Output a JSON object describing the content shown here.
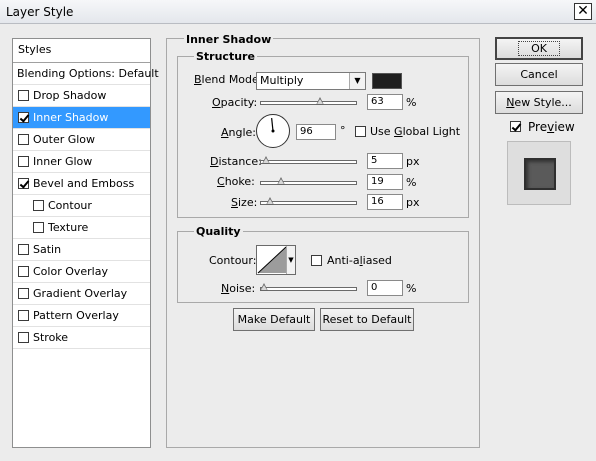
{
  "window": {
    "title": "Layer Style",
    "close_glyph": "✕"
  },
  "styles_panel": {
    "header": "Styles",
    "blending_options": "Blending Options: Default",
    "items": [
      {
        "label": "Drop Shadow",
        "checked": false,
        "active": false,
        "sub": false
      },
      {
        "label": "Inner Shadow",
        "checked": true,
        "active": true,
        "sub": false
      },
      {
        "label": "Outer Glow",
        "checked": false,
        "active": false,
        "sub": false
      },
      {
        "label": "Inner Glow",
        "checked": false,
        "active": false,
        "sub": false
      },
      {
        "label": "Bevel and Emboss",
        "checked": true,
        "active": false,
        "sub": false
      },
      {
        "label": "Contour",
        "checked": false,
        "active": false,
        "sub": true
      },
      {
        "label": "Texture",
        "checked": false,
        "active": false,
        "sub": true
      },
      {
        "label": "Satin",
        "checked": false,
        "active": false,
        "sub": false
      },
      {
        "label": "Color Overlay",
        "checked": false,
        "active": false,
        "sub": false
      },
      {
        "label": "Gradient Overlay",
        "checked": false,
        "active": false,
        "sub": false
      },
      {
        "label": "Pattern Overlay",
        "checked": false,
        "active": false,
        "sub": false
      },
      {
        "label": "Stroke",
        "checked": false,
        "active": false,
        "sub": false
      }
    ]
  },
  "inner_shadow": {
    "section_title": "Inner Shadow",
    "structure": {
      "title": "Structure",
      "blend_mode_label": "Blend Mode:",
      "blend_mode_value": "Multiply",
      "blend_color": "#1f1f1f",
      "opacity_label": "Opacity:",
      "opacity_value": "63",
      "opacity_unit": "%",
      "opacity_level": 0.63,
      "angle_label": "Angle:",
      "angle_value": "96",
      "angle_unit": "°",
      "angle_degrees": 96,
      "use_global_light_label": "Use Global Light",
      "use_global_light_checked": false,
      "distance_label": "Distance:",
      "distance_value": "5",
      "distance_unit": "px",
      "distance_level": 0.02,
      "choke_label": "Choke:",
      "choke_value": "19",
      "choke_unit": "%",
      "choke_level": 0.19,
      "size_label": "Size:",
      "size_value": "16",
      "size_unit": "px",
      "size_level": 0.065
    },
    "quality": {
      "title": "Quality",
      "contour_label": "Contour:",
      "anti_aliased_label": "Anti-aliased",
      "anti_aliased_checked": false,
      "noise_label": "Noise:",
      "noise_value": "0",
      "noise_unit": "%",
      "noise_level": 0
    },
    "make_default_label": "Make Default",
    "reset_default_label": "Reset to Default"
  },
  "actions": {
    "ok_label": "OK",
    "cancel_label": "Cancel",
    "new_style_label": "New Style...",
    "preview_label": "Preview",
    "preview_checked": true
  }
}
